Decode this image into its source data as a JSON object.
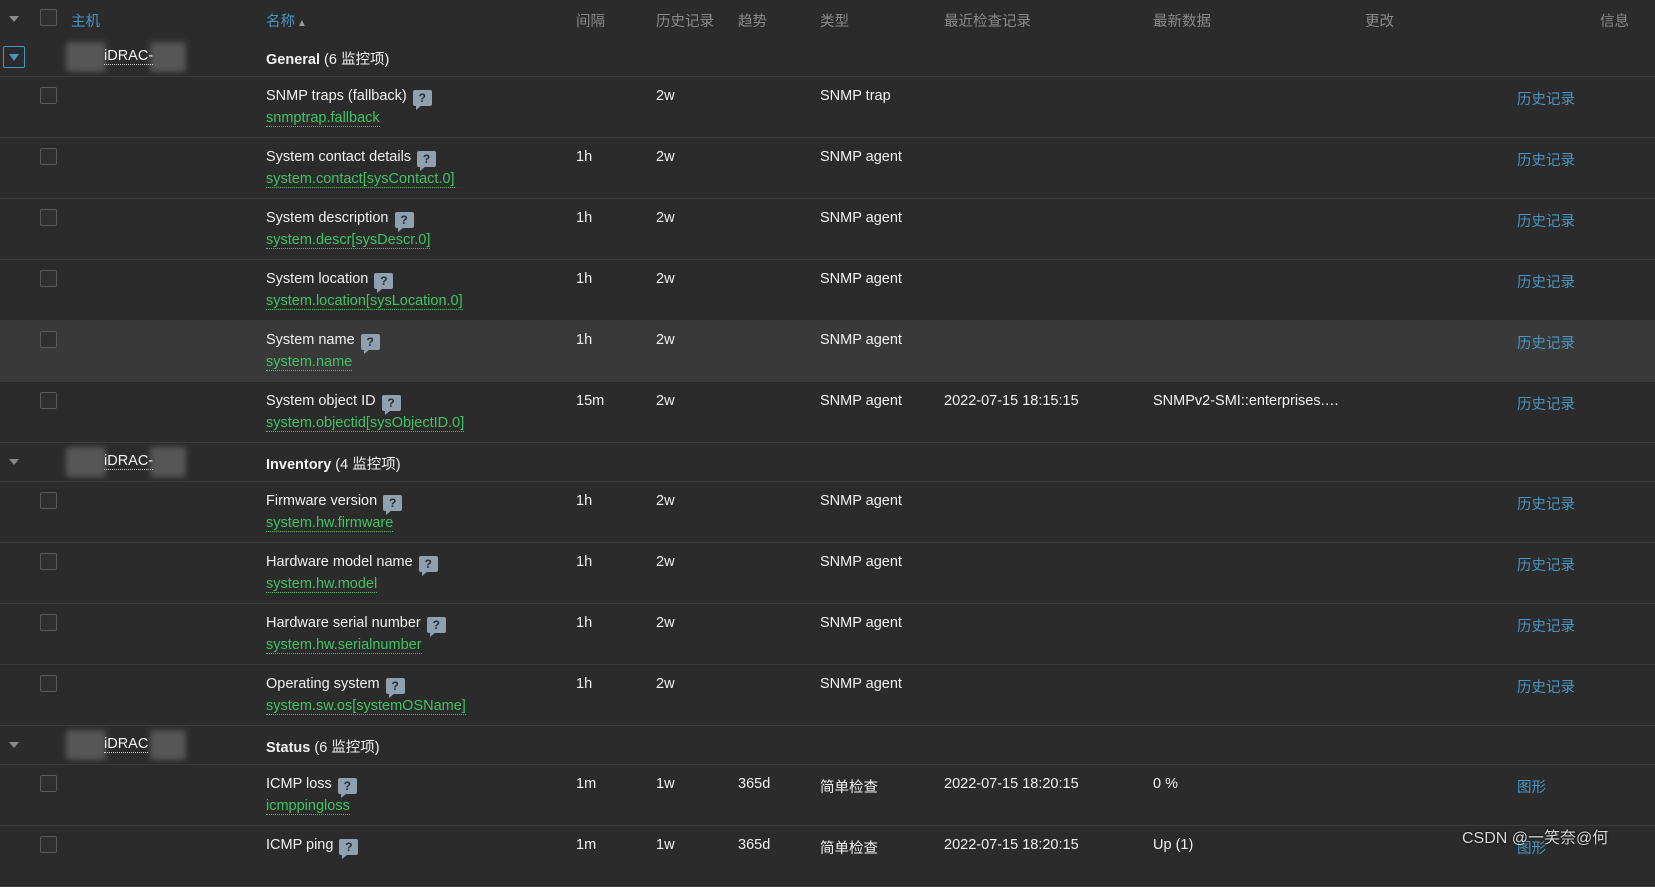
{
  "header": {
    "host": "主机",
    "name": "名称",
    "interval": "间隔",
    "history": "历史记录",
    "trends": "趋势",
    "type": "类型",
    "last_check": "最近检查记录",
    "last_value": "最新数据",
    "change": "更改",
    "info": "信息"
  },
  "groups": [
    {
      "host": "iDRAC-",
      "name": "General",
      "count": "(6 监控项)",
      "expanded_box": true,
      "items": [
        {
          "name": "SNMP traps (fallback)",
          "key": "snmptrap.fallback",
          "interval": "",
          "history": "2w",
          "trends": "",
          "type": "SNMP trap",
          "last_check": "",
          "last_value": "",
          "link": "历史记录"
        },
        {
          "name": "System contact details",
          "key": "system.contact[sysContact.0]",
          "interval": "1h",
          "history": "2w",
          "trends": "",
          "type": "SNMP agent",
          "last_check": "",
          "last_value": "",
          "link": "历史记录"
        },
        {
          "name": "System description",
          "key": "system.descr[sysDescr.0]",
          "interval": "1h",
          "history": "2w",
          "trends": "",
          "type": "SNMP agent",
          "last_check": "",
          "last_value": "",
          "link": "历史记录"
        },
        {
          "name": "System location",
          "key": "system.location[sysLocation.0]",
          "interval": "1h",
          "history": "2w",
          "trends": "",
          "type": "SNMP agent",
          "last_check": "",
          "last_value": "",
          "link": "历史记录"
        },
        {
          "name": "System name",
          "key": "system.name",
          "interval": "1h",
          "history": "2w",
          "trends": "",
          "type": "SNMP agent",
          "last_check": "",
          "last_value": "",
          "link": "历史记录",
          "highlight": true
        },
        {
          "name": "System object ID",
          "key": "system.objectid[sysObjectID.0]",
          "interval": "15m",
          "history": "2w",
          "trends": "",
          "type": "SNMP agent",
          "last_check": "2022-07-15 18:15:15",
          "last_value": "SNMPv2-SMI::enterprises.…",
          "link": "历史记录"
        }
      ]
    },
    {
      "host": "iDRAC-",
      "name": "Inventory",
      "count": "(4 监控项)",
      "expanded_box": false,
      "items": [
        {
          "name": "Firmware version",
          "key": "system.hw.firmware",
          "interval": "1h",
          "history": "2w",
          "trends": "",
          "type": "SNMP agent",
          "last_check": "",
          "last_value": "",
          "link": "历史记录"
        },
        {
          "name": "Hardware model name",
          "key": "system.hw.model",
          "interval": "1h",
          "history": "2w",
          "trends": "",
          "type": "SNMP agent",
          "last_check": "",
          "last_value": "",
          "link": "历史记录"
        },
        {
          "name": "Hardware serial number",
          "key": "system.hw.serialnumber",
          "interval": "1h",
          "history": "2w",
          "trends": "",
          "type": "SNMP agent",
          "last_check": "",
          "last_value": "",
          "link": "历史记录"
        },
        {
          "name": "Operating system",
          "key": "system.sw.os[systemOSName]",
          "interval": "1h",
          "history": "2w",
          "trends": "",
          "type": "SNMP agent",
          "last_check": "",
          "last_value": "",
          "link": "历史记录"
        }
      ]
    },
    {
      "host": "iDRAC",
      "name": "Status",
      "count": "(6 监控项)",
      "expanded_box": false,
      "items": [
        {
          "name": "ICMP loss",
          "key": "icmppingloss",
          "interval": "1m",
          "history": "1w",
          "trends": "365d",
          "type": "简单检查",
          "last_check": "2022-07-15 18:20:15",
          "last_value": "0 %",
          "link": "图形"
        },
        {
          "name": "ICMP ping",
          "key": "",
          "interval": "1m",
          "history": "1w",
          "trends": "365d",
          "type": "简单检查",
          "last_check": "2022-07-15 18:20:15",
          "last_value": "Up (1)",
          "link": "图形"
        }
      ]
    }
  ],
  "watermark": "CSDN @一笑奈@何",
  "icons": {
    "help": "question-bubble-icon",
    "toggle": "triangle-down-icon"
  }
}
